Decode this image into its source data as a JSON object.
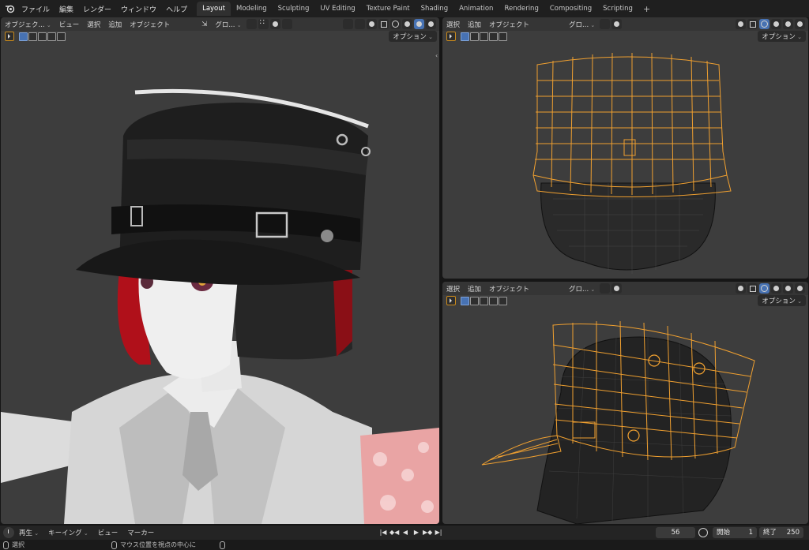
{
  "topbar": {
    "menus": [
      "ファイル",
      "編集",
      "レンダー",
      "ウィンドウ",
      "ヘルプ"
    ],
    "tabs": [
      "Layout",
      "Modeling",
      "Sculpting",
      "UV Editing",
      "Texture Paint",
      "Shading",
      "Animation",
      "Rendering",
      "Compositing",
      "Scripting"
    ],
    "active_tab": "Layout",
    "add_tab": "+"
  },
  "main_viewport": {
    "mode": "オブジェク...",
    "menus": [
      "ビュー",
      "選択",
      "追加",
      "オブジェクト"
    ],
    "transform": "グロ...",
    "options": "オプション"
  },
  "top_viewport": {
    "menus": [
      "選択",
      "追加",
      "オブジェクト"
    ],
    "transform": "グロ...",
    "options": "オプション"
  },
  "bottom_viewport": {
    "menus": [
      "選択",
      "追加",
      "オブジェクト"
    ],
    "transform": "グロ...",
    "options": "オプション"
  },
  "timeline": {
    "playback": "再生",
    "keying": "キーイング",
    "view": "ビュー",
    "marker": "マーカー",
    "current_frame": "56",
    "start_label": "開始",
    "start_value": "1",
    "end_label": "終了",
    "end_value": "250"
  },
  "statusbar": {
    "select": "選択",
    "center_view": "マウス位置を視点の中心に"
  },
  "colors": {
    "accent_blue": "#4772b3",
    "selection_orange": "#f0a030",
    "viewport_bg": "#3d3d3d"
  }
}
